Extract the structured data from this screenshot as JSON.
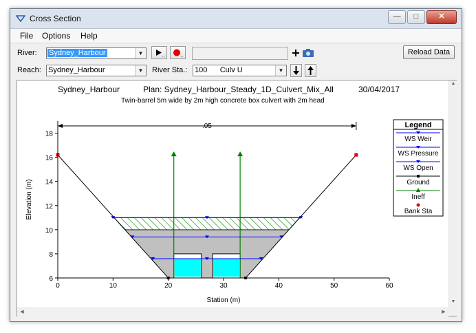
{
  "window": {
    "title": "Cross Section",
    "buttons": {
      "minimize": "—",
      "maximize": "□",
      "close": "✕"
    }
  },
  "menu": [
    "File",
    "Options",
    "Help"
  ],
  "toolbar": {
    "river_label": "River:",
    "river_value": "Sydney_Harbour",
    "reach_label": "Reach:",
    "reach_value": "Sydney_Harbour",
    "river_sta_label": "River Sta.:",
    "river_sta_value": "100      Culv U",
    "reload_label": "Reload Data",
    "icons": [
      "play-icon",
      "record-icon",
      "add-icon",
      "camera-icon",
      "arrow-down-icon",
      "arrow-up-icon"
    ]
  },
  "chart_data": {
    "type": "cross-section",
    "title_left": "Sydney_Harbour",
    "title_plan": "Plan: Sydney_Harbour_Steady_1D_Culvert_Mix_All",
    "title_date": "30/04/2017",
    "subtitle": "Twin-barrel 5m wide by 2m high concrete box culvert with 2m head",
    "xlabel": "Station (m)",
    "ylabel": "Elevation (m)",
    "xlim": [
      0,
      60
    ],
    "ylim": [
      6,
      19
    ],
    "x_ticks": [
      0,
      10,
      20,
      30,
      40,
      50,
      60
    ],
    "y_ticks": [
      6,
      8,
      10,
      12,
      14,
      16,
      18
    ],
    "manning_label": ".05",
    "manning_x": [
      0,
      54
    ],
    "manning_y": 18.6,
    "ground": [
      [
        0,
        16.2
      ],
      [
        20,
        6
      ],
      [
        34,
        6
      ],
      [
        54,
        16.2
      ]
    ],
    "bank_stations": [
      [
        0,
        16.2
      ],
      [
        54,
        16.2
      ]
    ],
    "ineff": [
      {
        "x": 21,
        "y": 16.2
      },
      {
        "x": 33,
        "y": 16.2
      }
    ],
    "culvert_barrels": [
      {
        "x0": 21,
        "x1": 26,
        "bottom": 6,
        "top": 8
      },
      {
        "x0": 28,
        "x1": 33,
        "bottom": 6,
        "top": 8
      }
    ],
    "deck": {
      "top": 10,
      "bottom": 8
    },
    "road_fill_top": 11,
    "water_surfaces": [
      {
        "name": "WS Weir",
        "elev": 11,
        "x": [
          10,
          44
        ]
      },
      {
        "name": "WS Pressure",
        "elev": 9.4,
        "x": [
          13.5,
          40.5
        ]
      },
      {
        "name": "WS Open",
        "elev": 7.6,
        "x": [
          17.2,
          36.8
        ]
      }
    ],
    "legend": {
      "title": "Legend",
      "entries": [
        "WS Weir",
        "WS Pressure",
        "WS Open",
        "Ground",
        "Ineff",
        "Bank Sta"
      ]
    },
    "colors": {
      "ws": "#0000ff",
      "ground": "#000000",
      "ineff": "#008000",
      "bank": "#e00000",
      "water_in_culvert": "#00ffff",
      "fill": "#c0c0c0",
      "hatch": "#008000"
    }
  }
}
